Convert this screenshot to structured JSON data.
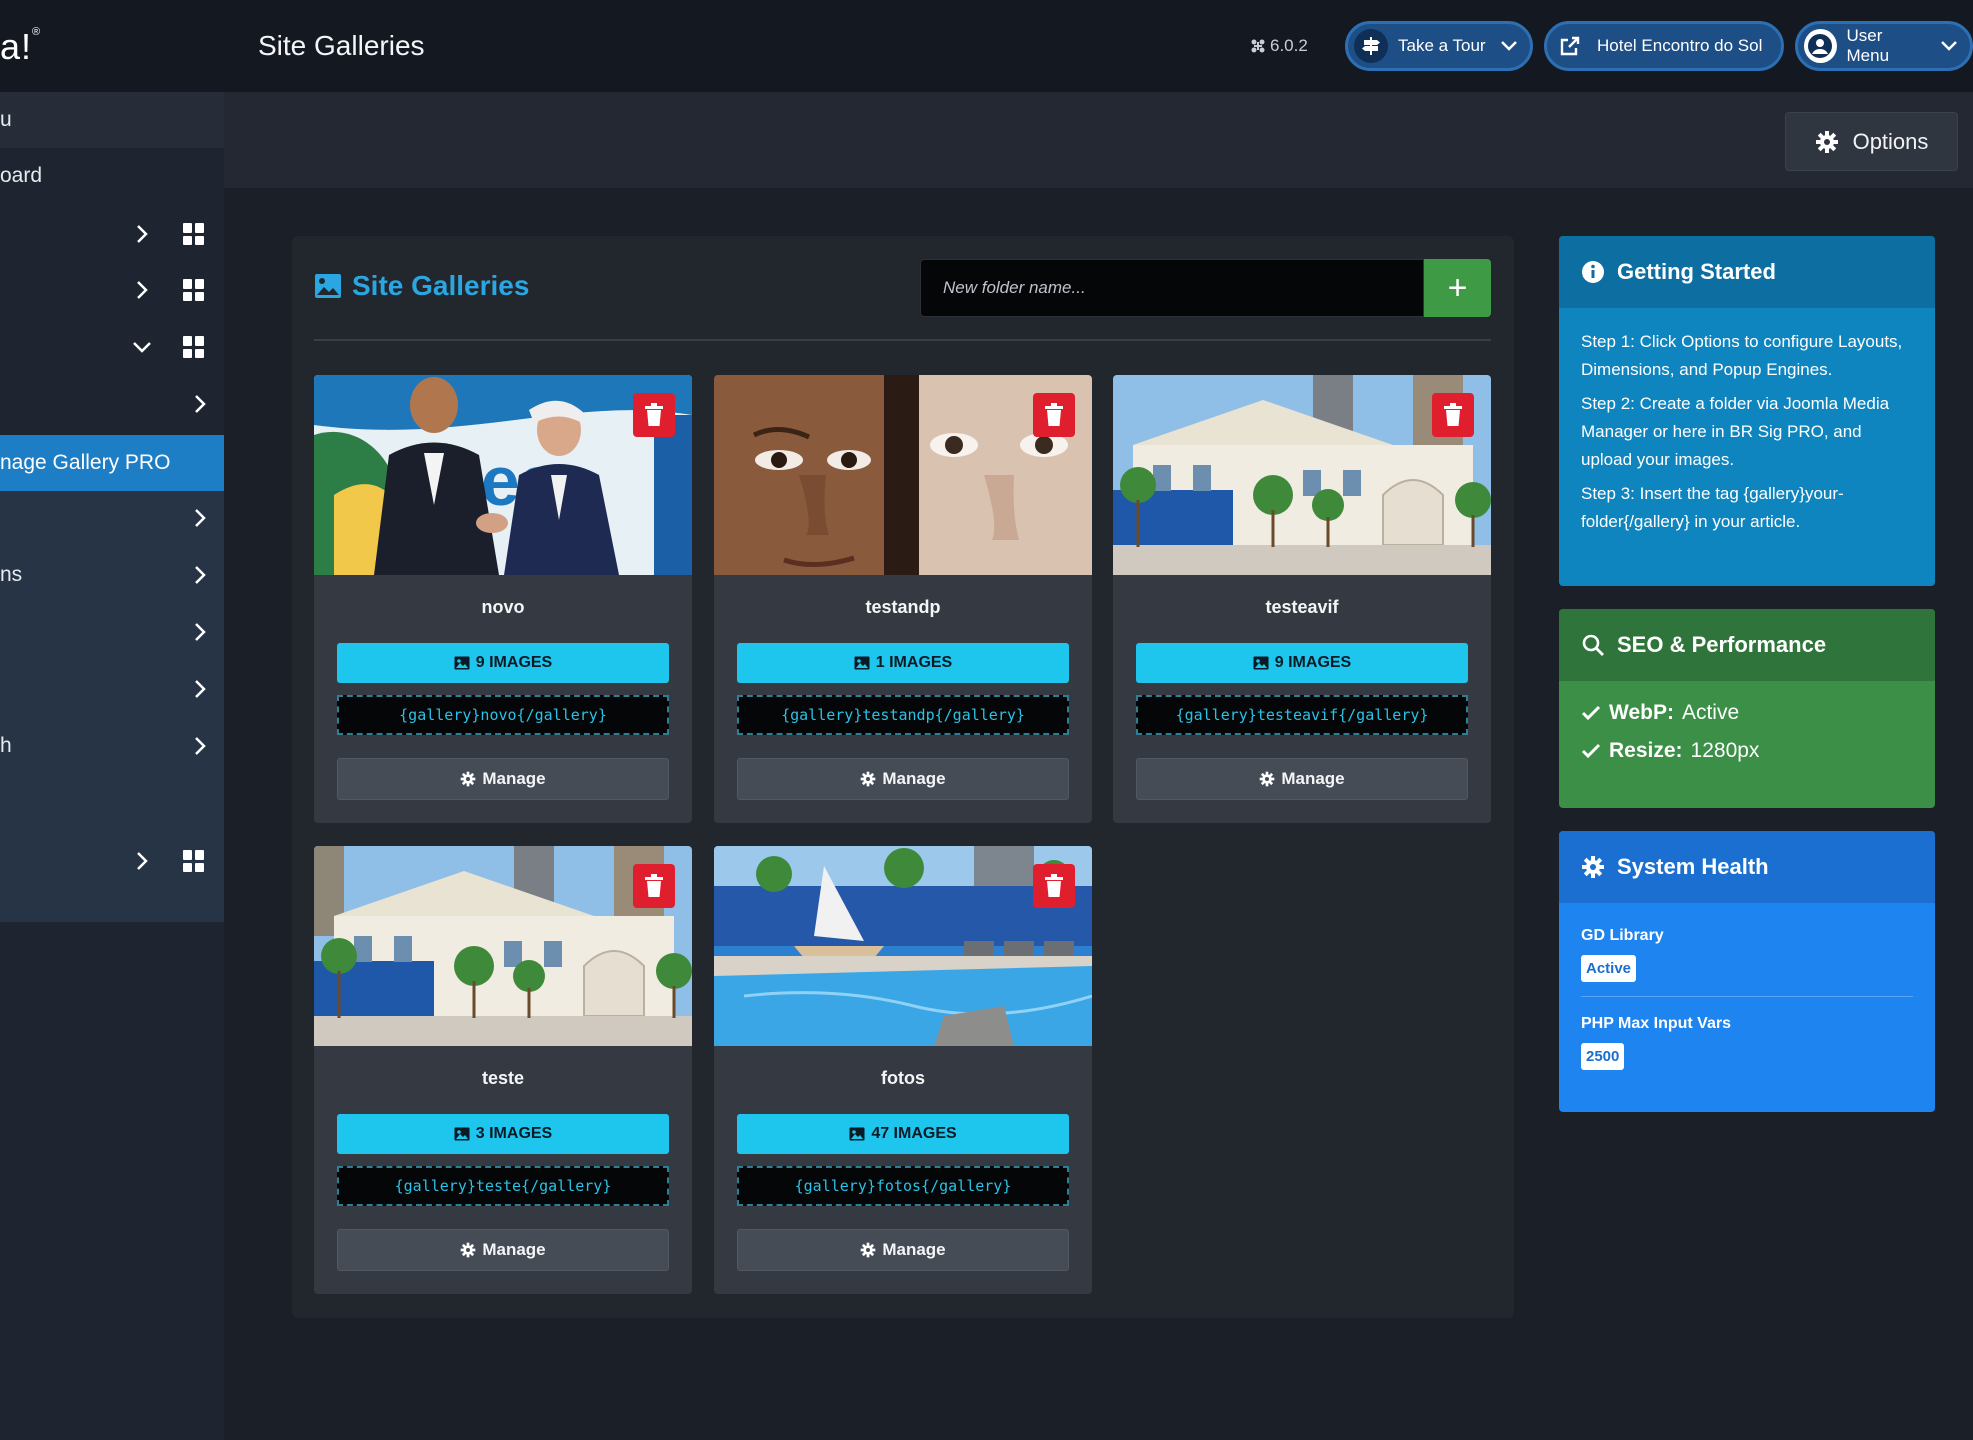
{
  "header": {
    "brand": "a!",
    "brand_sup": "®",
    "title": "Site Galleries",
    "version": "6.0.2",
    "take_tour": "Take a Tour",
    "site_link": "Hotel Encontro do Sol",
    "user_menu": "User Menu"
  },
  "sidebar": {
    "items": [
      {
        "label": "u"
      },
      {
        "label": "oard"
      },
      {
        "label": ""
      },
      {
        "label": ""
      },
      {
        "label": ""
      },
      {
        "label": ""
      },
      {
        "label": "nage Gallery PRO"
      },
      {
        "label": ""
      },
      {
        "label": "ns"
      },
      {
        "label": ""
      },
      {
        "label": ""
      },
      {
        "label": "h"
      },
      {
        "label": ""
      }
    ]
  },
  "toolbar": {
    "options_label": "Options"
  },
  "gallery": {
    "title": "Site Galleries",
    "new_folder_placeholder": "New folder name...",
    "add_label": "+",
    "folders": [
      {
        "name": "novo",
        "count": "9 IMAGES",
        "tag": "{gallery}novo{/gallery}",
        "manage": "Manage"
      },
      {
        "name": "testandp",
        "count": "1 IMAGES",
        "tag": "{gallery}testandp{/gallery}",
        "manage": "Manage"
      },
      {
        "name": "testeavif",
        "count": "9 IMAGES",
        "tag": "{gallery}testeavif{/gallery}",
        "manage": "Manage"
      },
      {
        "name": "teste",
        "count": "3 IMAGES",
        "tag": "{gallery}teste{/gallery}",
        "manage": "Manage"
      },
      {
        "name": "fotos",
        "count": "47 IMAGES",
        "tag": "{gallery}fotos{/gallery}",
        "manage": "Manage"
      }
    ]
  },
  "widgets": {
    "getting_started": {
      "title": "Getting Started",
      "steps": [
        "Step 1: Click Options to configure Layouts, Dimensions, and Popup Engines.",
        "Step 2: Create a folder via Joomla Media Manager or here in BR Sig PRO, and upload your images.",
        "Step 3: Insert the tag {gallery}your-folder{/gallery} in your article."
      ]
    },
    "seo": {
      "title": "SEO & Performance",
      "webp_label": "WebP:",
      "webp_value": "Active",
      "resize_label": "Resize:",
      "resize_value": "1280px"
    },
    "health": {
      "title": "System Health",
      "gd_label": "GD Library",
      "gd_value": "Active",
      "php_label": "PHP Max Input Vars",
      "php_value": "2500"
    }
  },
  "colors": {
    "accent_blue": "#2aa7e2",
    "count_cyan": "#1ec6ee",
    "delete_red": "#e01f2e",
    "add_green": "#3f9a45",
    "sidebar_active": "#1d7ec5"
  }
}
